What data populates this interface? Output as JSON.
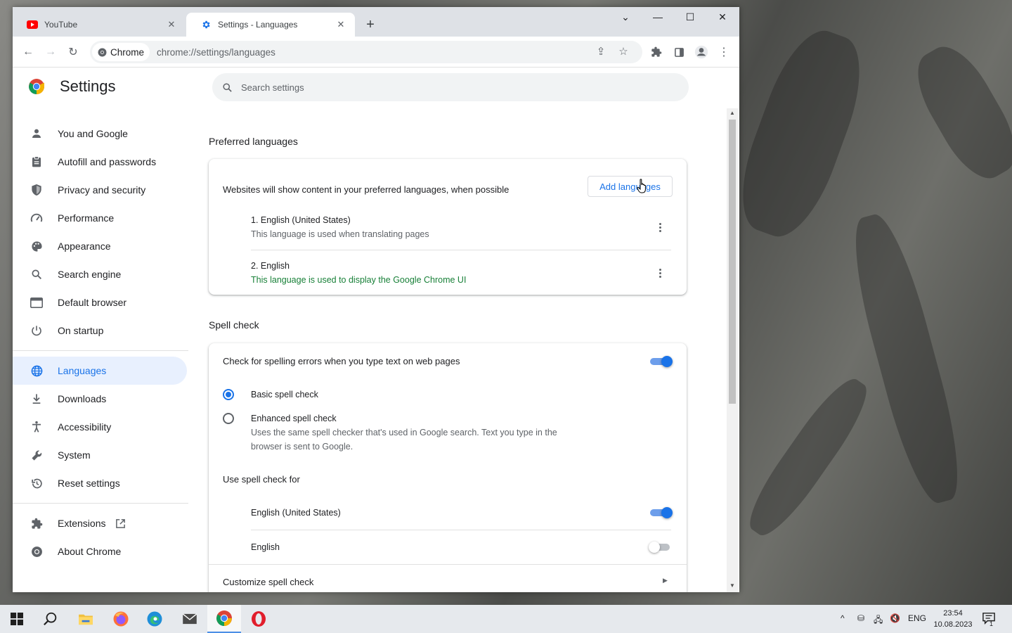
{
  "browser": {
    "tabs": [
      {
        "title": "YouTube",
        "icon": "youtube-icon",
        "active": false
      },
      {
        "title": "Settings - Languages",
        "icon": "gear-icon",
        "active": true
      }
    ],
    "chip_label": "Chrome",
    "url": "chrome://settings/languages"
  },
  "settings": {
    "title": "Settings",
    "search_placeholder": "Search settings",
    "nav": [
      {
        "label": "You and Google",
        "icon": "person-icon"
      },
      {
        "label": "Autofill and passwords",
        "icon": "clipboard-icon"
      },
      {
        "label": "Privacy and security",
        "icon": "shield-icon"
      },
      {
        "label": "Performance",
        "icon": "speedometer-icon"
      },
      {
        "label": "Appearance",
        "icon": "palette-icon"
      },
      {
        "label": "Search engine",
        "icon": "search-icon"
      },
      {
        "label": "Default browser",
        "icon": "browser-window-icon"
      },
      {
        "label": "On startup",
        "icon": "power-icon"
      },
      {
        "label": "Languages",
        "icon": "globe-icon"
      },
      {
        "label": "Downloads",
        "icon": "download-icon"
      },
      {
        "label": "Accessibility",
        "icon": "accessibility-icon"
      },
      {
        "label": "System",
        "icon": "wrench-icon"
      },
      {
        "label": "Reset settings",
        "icon": "history-icon"
      },
      {
        "label": "Extensions",
        "icon": "puzzle-icon"
      },
      {
        "label": "About Chrome",
        "icon": "chrome-icon"
      }
    ],
    "preferred": {
      "section_title": "Preferred languages",
      "description": "Websites will show content in your preferred languages, when possible",
      "add_button": "Add languages",
      "languages": [
        {
          "name": "1. English (United States)",
          "note": "This language is used when translating pages"
        },
        {
          "name": "2. English",
          "note": "This language is used to display the Google Chrome UI"
        }
      ]
    },
    "spell": {
      "section_title": "Spell check",
      "toggle_label": "Check for spelling errors when you type text on web pages",
      "toggle_on": true,
      "basic_label": "Basic spell check",
      "enhanced_label": "Enhanced spell check",
      "enhanced_desc_1": "Uses the same spell checker that's used in Google search. Text you type in the",
      "enhanced_desc_2": "browser is sent to Google.",
      "use_for_label": "Use spell check for",
      "languages": [
        {
          "name": "English (United States)",
          "on": true
        },
        {
          "name": "English",
          "on": false
        }
      ],
      "customize_label": "Customize spell check"
    }
  },
  "taskbar": {
    "lang": "ENG",
    "time": "23:54",
    "date": "10.08.2023",
    "notification_count": "1"
  },
  "colors": {
    "accent": "#1a73e8",
    "green_text": "#188038"
  }
}
